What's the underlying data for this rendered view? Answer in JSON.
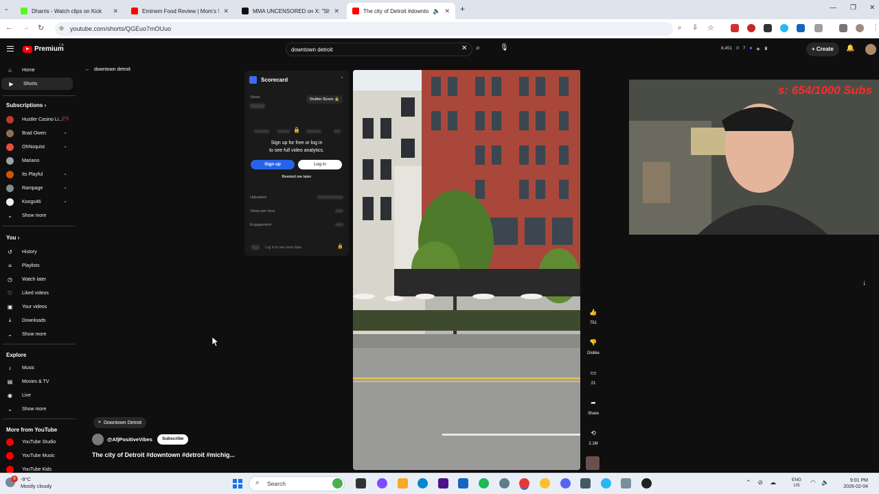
{
  "browser": {
    "tabs": [
      {
        "title": "Dharris - Watch clips on Kick",
        "favicon_color": "#53fc18",
        "active": false
      },
      {
        "title": "Eminem Food Review | Mom's S",
        "favicon_color": "#ff0000",
        "active": false
      },
      {
        "title": "MMA UNCENSORED on X: \"Sha",
        "favicon_color": "#111111",
        "active": false
      },
      {
        "title": "The city of Detroit #downto",
        "favicon_color": "#ff0000",
        "active": true
      }
    ],
    "url": "youtube.com/shorts/QGEuo7mOUuo"
  },
  "youtube": {
    "logo_text": "Premium",
    "country_code": "CA",
    "search_value": "downtown detroit",
    "stats": [
      "8,451",
      "0",
      "7"
    ],
    "create_label": "Create",
    "sidebar": {
      "main": [
        {
          "label": "Home",
          "icon": "home-icon",
          "glyph": "⌂"
        },
        {
          "label": "Shorts",
          "icon": "shorts-icon",
          "glyph": "▶"
        }
      ],
      "subscriptions_header": "Subscriptions",
      "subscriptions": [
        {
          "label": "Hustler Casino Li...",
          "color": "#c0392b",
          "live": true
        },
        {
          "label": "Brad Owen",
          "color": "#8e6e53",
          "live": false
        },
        {
          "label": "OhNoquist",
          "color": "#e74c3c",
          "live": false
        },
        {
          "label": "Mariano",
          "color": "#95a5a6",
          "live": false
        },
        {
          "label": "Its Playful",
          "color": "#d35400",
          "live": false
        },
        {
          "label": "Rampage",
          "color": "#7f8c8d",
          "live": false
        },
        {
          "label": "Koogs46",
          "color": "#ecf0f1",
          "live": false
        }
      ],
      "show_more": "Show more",
      "you_header": "You",
      "you": [
        {
          "label": "History",
          "icon": "history-icon",
          "glyph": "↺"
        },
        {
          "label": "Playlists",
          "icon": "playlists-icon",
          "glyph": "≡"
        },
        {
          "label": "Watch later",
          "icon": "watch-later-icon",
          "glyph": "◷"
        },
        {
          "label": "Liked videos",
          "icon": "liked-videos-icon",
          "glyph": "👍"
        },
        {
          "label": "Your videos",
          "icon": "your-videos-icon",
          "glyph": "▣"
        },
        {
          "label": "Downloads",
          "icon": "downloads-icon",
          "glyph": "⤓"
        }
      ],
      "explore_header": "Explore",
      "explore": [
        {
          "label": "Music",
          "icon": "music-icon",
          "glyph": "♪"
        },
        {
          "label": "Movies & TV",
          "icon": "movies-icon",
          "glyph": "▤"
        },
        {
          "label": "Live",
          "icon": "live-icon",
          "glyph": "◉"
        }
      ],
      "more_header": "More from YouTube",
      "more": [
        {
          "label": "YouTube Studio",
          "color": "#ff0000"
        },
        {
          "label": "YouTube Music",
          "color": "#ff0000"
        },
        {
          "label": "YouTube Kids",
          "color": "#ff0000"
        }
      ]
    },
    "back_label": "downtown detroit",
    "scorecard": {
      "title": "Scorecard",
      "views_label": "Views",
      "outlier_label": "Outlier Score",
      "cta_line1": "Sign up for free or log in",
      "cta_line2": "to see full video analytics.",
      "signup_label": "Sign up",
      "login_label": "Log in",
      "remind_label": "Remind me later",
      "uploaded_label": "Uploaded",
      "views_per_hour_label": "Views per hour",
      "engagement_label": "Engagement",
      "footer_label": "Log in to see more data"
    },
    "actions": {
      "likes": "751",
      "dislike_label": "Dislike",
      "comments": "21",
      "share_label": "Share",
      "remix_count": "2.1M"
    },
    "webcam_overlay": "s: 654/1000 Subs",
    "video_info": {
      "location": "Downtown Detroit",
      "channel": "@AfjPositiveVibes",
      "subscribe_label": "Subscribe",
      "title": "The city of Detroit #downtown #detroit #michig..."
    }
  },
  "taskbar": {
    "weather_temp": "-9°C",
    "weather_desc": "Mostly cloudy",
    "weather_badge": "8",
    "search_placeholder": "Search",
    "lang_line1": "ENG",
    "lang_line2": "US",
    "time": "9:01 PM",
    "date": "2026-02-04"
  }
}
